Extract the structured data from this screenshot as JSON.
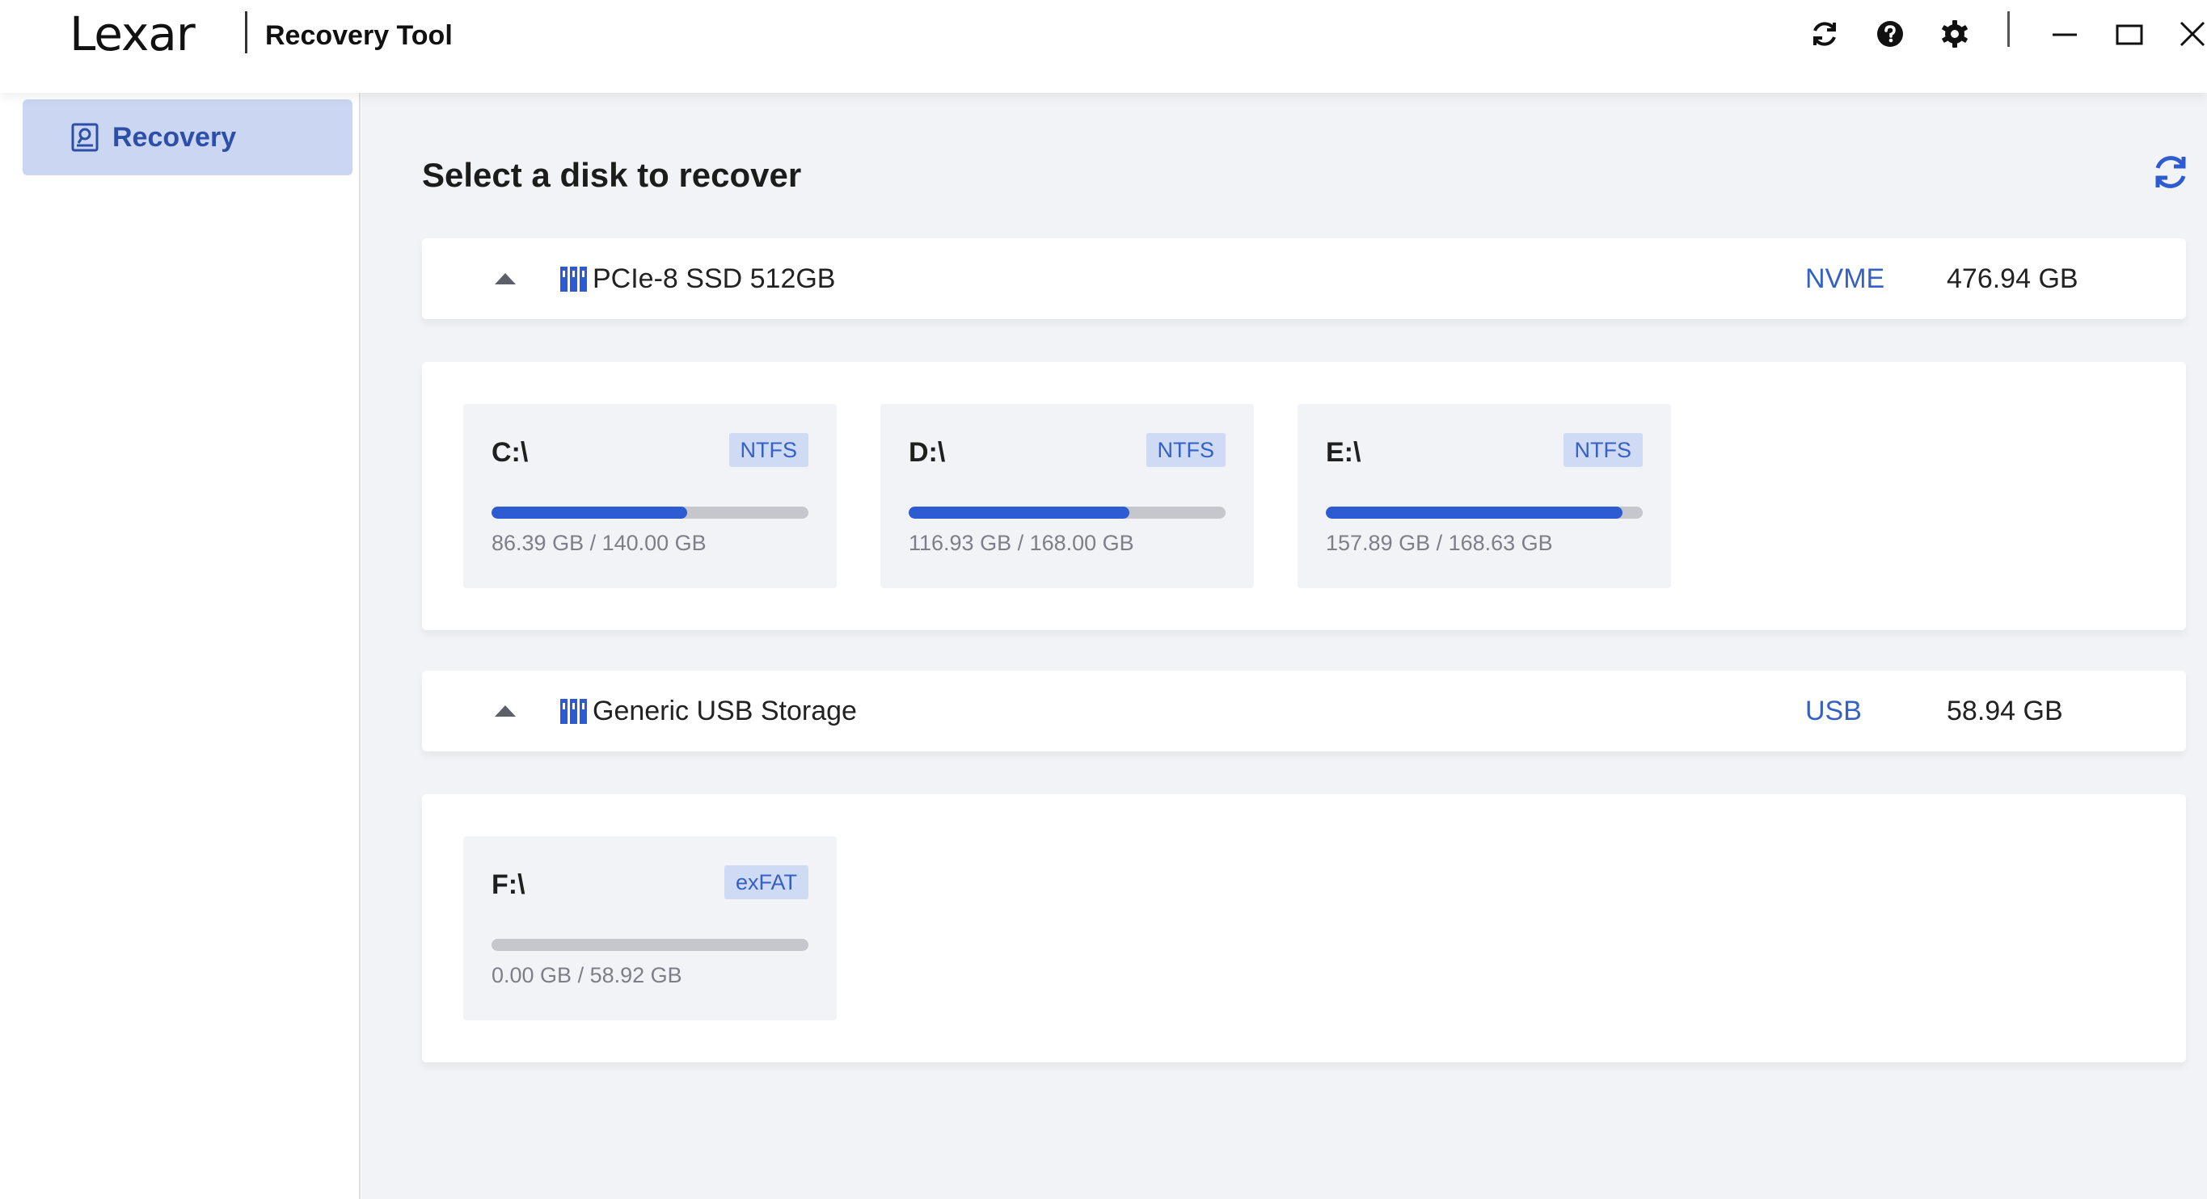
{
  "app": {
    "brand": "Lexar",
    "title": "Recovery Tool"
  },
  "toolbar": {
    "icons": [
      "refresh-icon",
      "help-icon",
      "settings-icon",
      "minimize-icon",
      "maximize-icon",
      "close-icon"
    ]
  },
  "sidebar": {
    "items": [
      {
        "label": "Recovery",
        "icon": "recovery-disk-icon",
        "selected": true
      }
    ]
  },
  "main": {
    "title": "Select a disk to recover",
    "disks": [
      {
        "name": "PCIe-8 SSD 512GB",
        "interface": "NVME",
        "size": "476.94 GB",
        "expanded": true,
        "partitions": [
          {
            "drive": "C:\\",
            "fs": "NTFS",
            "usage": "86.39 GB / 140.00 GB",
            "used_fraction": 0.617
          },
          {
            "drive": "D:\\",
            "fs": "NTFS",
            "usage": "116.93 GB / 168.00 GB",
            "used_fraction": 0.696
          },
          {
            "drive": "E:\\",
            "fs": "NTFS",
            "usage": "157.89 GB / 168.63 GB",
            "used_fraction": 0.936
          }
        ]
      },
      {
        "name": "Generic USB Storage",
        "interface": "USB",
        "size": "58.94 GB",
        "expanded": true,
        "partitions": [
          {
            "drive": "F:\\",
            "fs": "exFAT",
            "usage": "0.00 GB / 58.92 GB",
            "used_fraction": 0.0
          }
        ]
      }
    ]
  },
  "colors": {
    "accent": "#2d5bd2",
    "accent_text": "#3560c4",
    "sidebar_selected_bg": "#cad6f2",
    "main_bg": "#f2f3f6",
    "bar_track": "#c5c7cc",
    "brand_red": "#e4202a"
  }
}
